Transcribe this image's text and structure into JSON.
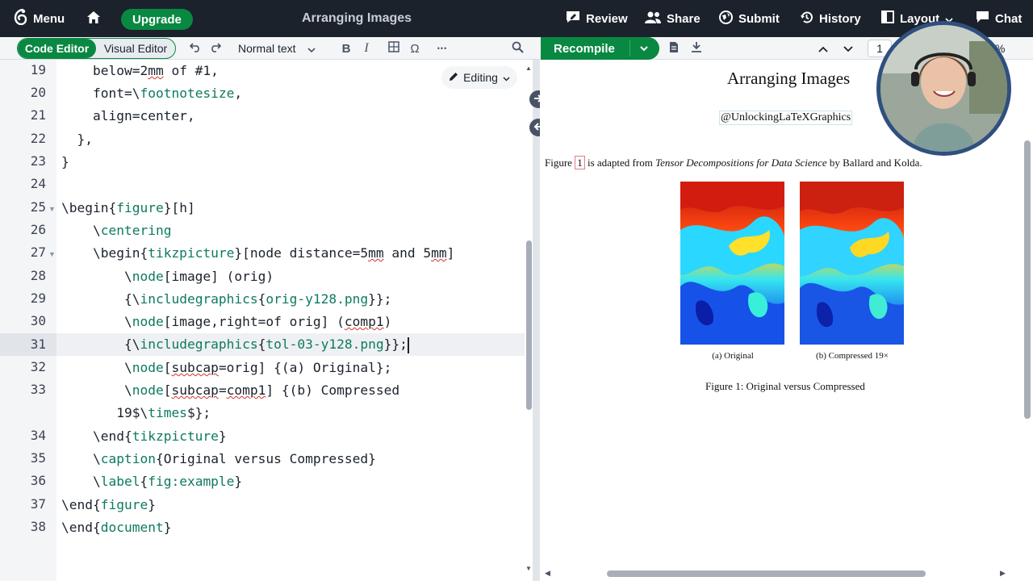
{
  "topbar": {
    "menu_label": "Menu",
    "upgrade_label": "Upgrade",
    "project_title": "Arranging Images",
    "review_label": "Review",
    "share_label": "Share",
    "submit_label": "Submit",
    "history_label": "History",
    "layout_label": "Layout",
    "chat_label": "Chat"
  },
  "editor_toolbar": {
    "code_editor_label": "Code Editor",
    "visual_editor_label": "Visual Editor",
    "style_select_value": "Normal text",
    "bold_label": "B",
    "italic_label": "I",
    "omega_label": "Ω",
    "more_label": "•••"
  },
  "pdf_toolbar": {
    "recompile_label": "Recompile",
    "page_number": "1",
    "zoom_suffix": "%"
  },
  "editor": {
    "mode_badge": "Editing",
    "active_line": 31,
    "line_numbers": [
      "19",
      "20",
      "21",
      "22",
      "23",
      "24",
      "25",
      "26",
      "27",
      "28",
      "29",
      "30",
      "31",
      "32",
      "33",
      "",
      "34",
      "35",
      "36",
      "37",
      "38"
    ]
  },
  "pdf": {
    "title": "Arranging Images",
    "author": "@UnlockingLaTeXGraphics",
    "para_prefix": "Figure",
    "para_ref": "1",
    "para_mid": "is adapted from",
    "para_book": "Tensor Decompositions for Data Science",
    "para_suffix": "by Ballard and Kolda.",
    "subcaption_a": "(a) Original",
    "subcaption_b": "(b) Compressed 19×",
    "figure_caption": "Figure 1: Original versus Compressed"
  },
  "colors": {
    "topbar_bg": "#1b222c",
    "accent_green": "#098842",
    "latex_arg": "#0e7a5f"
  }
}
